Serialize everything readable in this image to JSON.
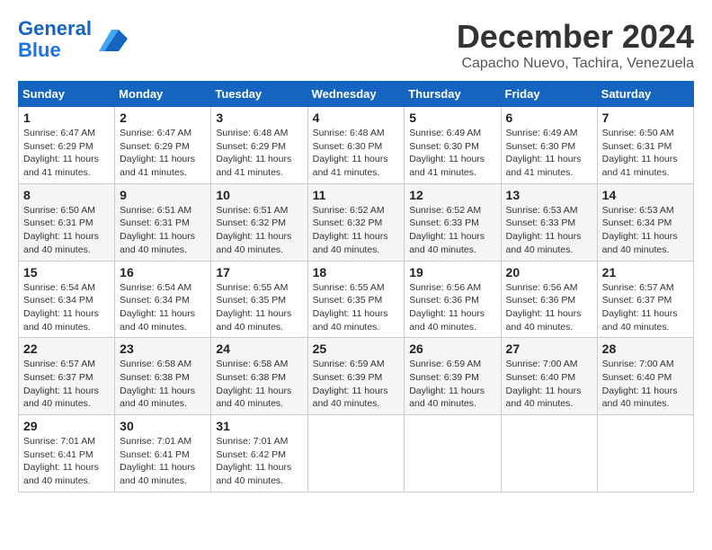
{
  "logo": {
    "line1": "General",
    "line2": "Blue"
  },
  "title": "December 2024",
  "location": "Capacho Nuevo, Tachira, Venezuela",
  "weekdays": [
    "Sunday",
    "Monday",
    "Tuesday",
    "Wednesday",
    "Thursday",
    "Friday",
    "Saturday"
  ],
  "weeks": [
    [
      {
        "day": "1",
        "sunrise": "6:47 AM",
        "sunset": "6:29 PM",
        "daylight": "11 hours and 41 minutes."
      },
      {
        "day": "2",
        "sunrise": "6:47 AM",
        "sunset": "6:29 PM",
        "daylight": "11 hours and 41 minutes."
      },
      {
        "day": "3",
        "sunrise": "6:48 AM",
        "sunset": "6:29 PM",
        "daylight": "11 hours and 41 minutes."
      },
      {
        "day": "4",
        "sunrise": "6:48 AM",
        "sunset": "6:30 PM",
        "daylight": "11 hours and 41 minutes."
      },
      {
        "day": "5",
        "sunrise": "6:49 AM",
        "sunset": "6:30 PM",
        "daylight": "11 hours and 41 minutes."
      },
      {
        "day": "6",
        "sunrise": "6:49 AM",
        "sunset": "6:30 PM",
        "daylight": "11 hours and 41 minutes."
      },
      {
        "day": "7",
        "sunrise": "6:50 AM",
        "sunset": "6:31 PM",
        "daylight": "11 hours and 41 minutes."
      }
    ],
    [
      {
        "day": "8",
        "sunrise": "6:50 AM",
        "sunset": "6:31 PM",
        "daylight": "11 hours and 40 minutes."
      },
      {
        "day": "9",
        "sunrise": "6:51 AM",
        "sunset": "6:31 PM",
        "daylight": "11 hours and 40 minutes."
      },
      {
        "day": "10",
        "sunrise": "6:51 AM",
        "sunset": "6:32 PM",
        "daylight": "11 hours and 40 minutes."
      },
      {
        "day": "11",
        "sunrise": "6:52 AM",
        "sunset": "6:32 PM",
        "daylight": "11 hours and 40 minutes."
      },
      {
        "day": "12",
        "sunrise": "6:52 AM",
        "sunset": "6:33 PM",
        "daylight": "11 hours and 40 minutes."
      },
      {
        "day": "13",
        "sunrise": "6:53 AM",
        "sunset": "6:33 PM",
        "daylight": "11 hours and 40 minutes."
      },
      {
        "day": "14",
        "sunrise": "6:53 AM",
        "sunset": "6:34 PM",
        "daylight": "11 hours and 40 minutes."
      }
    ],
    [
      {
        "day": "15",
        "sunrise": "6:54 AM",
        "sunset": "6:34 PM",
        "daylight": "11 hours and 40 minutes."
      },
      {
        "day": "16",
        "sunrise": "6:54 AM",
        "sunset": "6:34 PM",
        "daylight": "11 hours and 40 minutes."
      },
      {
        "day": "17",
        "sunrise": "6:55 AM",
        "sunset": "6:35 PM",
        "daylight": "11 hours and 40 minutes."
      },
      {
        "day": "18",
        "sunrise": "6:55 AM",
        "sunset": "6:35 PM",
        "daylight": "11 hours and 40 minutes."
      },
      {
        "day": "19",
        "sunrise": "6:56 AM",
        "sunset": "6:36 PM",
        "daylight": "11 hours and 40 minutes."
      },
      {
        "day": "20",
        "sunrise": "6:56 AM",
        "sunset": "6:36 PM",
        "daylight": "11 hours and 40 minutes."
      },
      {
        "day": "21",
        "sunrise": "6:57 AM",
        "sunset": "6:37 PM",
        "daylight": "11 hours and 40 minutes."
      }
    ],
    [
      {
        "day": "22",
        "sunrise": "6:57 AM",
        "sunset": "6:37 PM",
        "daylight": "11 hours and 40 minutes."
      },
      {
        "day": "23",
        "sunrise": "6:58 AM",
        "sunset": "6:38 PM",
        "daylight": "11 hours and 40 minutes."
      },
      {
        "day": "24",
        "sunrise": "6:58 AM",
        "sunset": "6:38 PM",
        "daylight": "11 hours and 40 minutes."
      },
      {
        "day": "25",
        "sunrise": "6:59 AM",
        "sunset": "6:39 PM",
        "daylight": "11 hours and 40 minutes."
      },
      {
        "day": "26",
        "sunrise": "6:59 AM",
        "sunset": "6:39 PM",
        "daylight": "11 hours and 40 minutes."
      },
      {
        "day": "27",
        "sunrise": "7:00 AM",
        "sunset": "6:40 PM",
        "daylight": "11 hours and 40 minutes."
      },
      {
        "day": "28",
        "sunrise": "7:00 AM",
        "sunset": "6:40 PM",
        "daylight": "11 hours and 40 minutes."
      }
    ],
    [
      {
        "day": "29",
        "sunrise": "7:01 AM",
        "sunset": "6:41 PM",
        "daylight": "11 hours and 40 minutes."
      },
      {
        "day": "30",
        "sunrise": "7:01 AM",
        "sunset": "6:41 PM",
        "daylight": "11 hours and 40 minutes."
      },
      {
        "day": "31",
        "sunrise": "7:01 AM",
        "sunset": "6:42 PM",
        "daylight": "11 hours and 40 minutes."
      },
      null,
      null,
      null,
      null
    ]
  ],
  "labels": {
    "sunrise": "Sunrise:",
    "sunset": "Sunset:",
    "daylight": "Daylight:"
  }
}
